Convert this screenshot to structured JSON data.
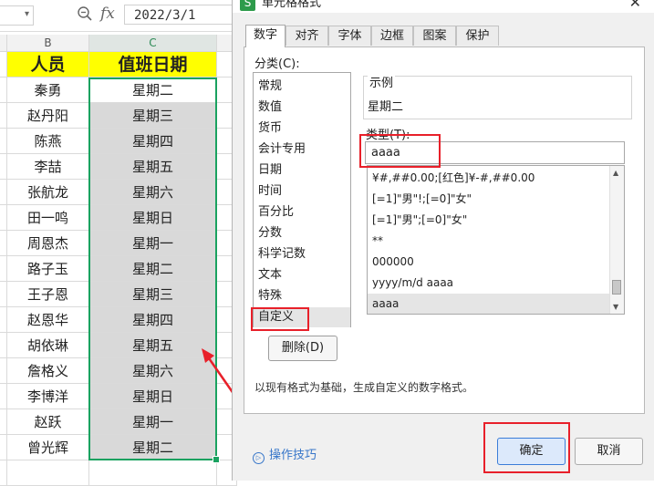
{
  "spreadsheet": {
    "formula_value": "2022/3/1",
    "fx_label": "fx",
    "col_b": "B",
    "col_c": "C",
    "header": {
      "name": "人员",
      "date": "值班日期"
    },
    "rows": [
      {
        "name": "秦勇",
        "day": "星期二"
      },
      {
        "name": "赵丹阳",
        "day": "星期三"
      },
      {
        "name": "陈燕",
        "day": "星期四"
      },
      {
        "name": "李喆",
        "day": "星期五"
      },
      {
        "name": "张航龙",
        "day": "星期六"
      },
      {
        "name": "田一鸣",
        "day": "星期日"
      },
      {
        "name": "周恩杰",
        "day": "星期一"
      },
      {
        "name": "路子玉",
        "day": "星期二"
      },
      {
        "name": "王子恩",
        "day": "星期三"
      },
      {
        "name": "赵恩华",
        "day": "星期四"
      },
      {
        "name": "胡依琳",
        "day": "星期五"
      },
      {
        "name": "詹格义",
        "day": "星期六"
      },
      {
        "name": "李博洋",
        "day": "星期日"
      },
      {
        "name": "赵跃",
        "day": "星期一"
      },
      {
        "name": "曾光辉",
        "day": "星期二"
      }
    ]
  },
  "dialog": {
    "title": "单元格格式",
    "logo": "S",
    "close": "✕",
    "tabs": [
      "数字",
      "对齐",
      "字体",
      "边框",
      "图案",
      "保护"
    ],
    "category_label": "分类(C):",
    "categories": [
      "常规",
      "数值",
      "货币",
      "会计专用",
      "日期",
      "时间",
      "百分比",
      "分数",
      "科学记数",
      "文本",
      "特殊",
      "自定义"
    ],
    "sample_label": "示例",
    "sample_value": "星期二",
    "type_label": "类型(T):",
    "type_value": "aaaa",
    "formats": [
      "¥#,##0.00;[红色]¥-#,##0.00",
      "[=1]\"男\"!;[=0]\"女\"",
      "[=1]\"男\";[=0]\"女\"",
      "**",
      "000000",
      "yyyy/m/d aaaa",
      "aaaa"
    ],
    "delete_label": "删除(D)",
    "description": "以现有格式为基础，生成自定义的数字格式。",
    "tips_label": "操作技巧",
    "ok_label": "确定",
    "cancel_label": "取消"
  }
}
